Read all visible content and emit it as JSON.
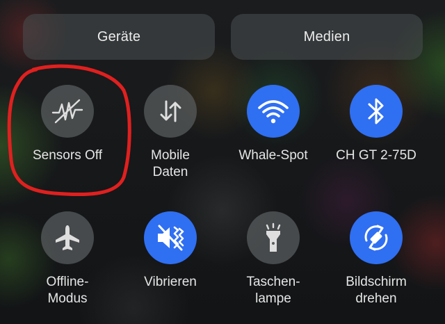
{
  "top_buttons": {
    "devices": "Geräte",
    "media": "Medien"
  },
  "tiles": [
    {
      "id": "sensors",
      "label": "Sensors Off",
      "icon": "sensors-off-icon",
      "active": false
    },
    {
      "id": "mobile-data",
      "label": "Mobile\nDaten",
      "icon": "mobile-data-arrows-icon",
      "active": false
    },
    {
      "id": "wifi",
      "label": "Whale-Spot",
      "icon": "wifi-icon",
      "active": true
    },
    {
      "id": "bluetooth",
      "label": "CH GT 2-75D",
      "icon": "bluetooth-icon",
      "active": true
    },
    {
      "id": "airplane",
      "label": "Offline-\nModus",
      "icon": "airplane-icon",
      "active": false
    },
    {
      "id": "vibrate",
      "label": "Vibrieren",
      "icon": "vibrate-icon",
      "active": true
    },
    {
      "id": "flashlight",
      "label": "Taschen-\nlampe",
      "icon": "flashlight-icon",
      "active": false
    },
    {
      "id": "rotate",
      "label": "Bildschirm\ndrehen",
      "icon": "auto-rotate-icon",
      "active": true
    }
  ],
  "colors": {
    "active_tile": "#2f6ff2",
    "inactive_tile": "#585c5e",
    "annotation": "#e0201f"
  }
}
